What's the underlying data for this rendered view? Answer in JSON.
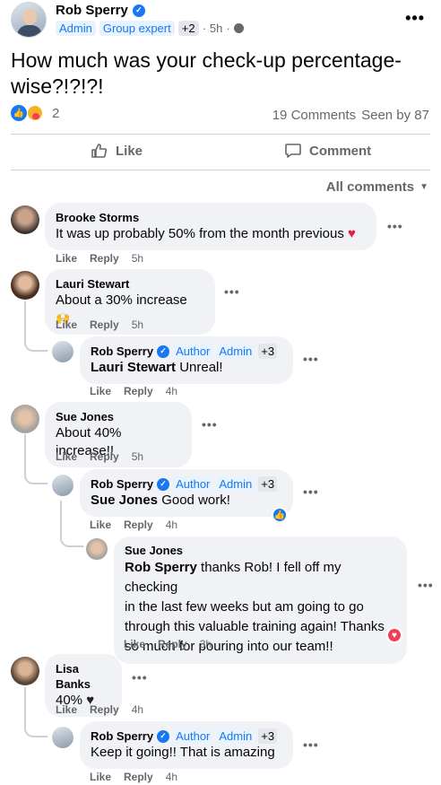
{
  "post": {
    "author": "Rob Sperry",
    "badges": [
      "Admin",
      "Group expert",
      "+2"
    ],
    "time": "5h",
    "text": "How much was your check-up percentage-wise?!?!?!",
    "reaction_count": "2",
    "comments_count": "19 Comments",
    "seen_by": "Seen by 87"
  },
  "actions": {
    "like": "Like",
    "comment": "Comment"
  },
  "filter": {
    "label": "All comments"
  },
  "comment_actions": {
    "like": "Like",
    "reply": "Reply"
  },
  "comments": [
    {
      "name": "Brooke Storms",
      "text": "It was up probably 50% from the month previous",
      "time": "5h"
    },
    {
      "name": "Lauri Stewart",
      "text": "About a 30% increase",
      "time": "5h"
    },
    {
      "name": "Rob Sperry",
      "badges": [
        "Author",
        "Admin",
        "+3"
      ],
      "tag": "Lauri Stewart",
      "text": "Unreal!",
      "time": "4h"
    },
    {
      "name": "Sue Jones",
      "text": "About 40% increase!!",
      "time": "5h"
    },
    {
      "name": "Rob Sperry",
      "badges": [
        "Author",
        "Admin",
        "+3"
      ],
      "tag": "Sue Jones",
      "text": "Good work!",
      "time": "4h"
    },
    {
      "name": "Sue Jones",
      "tag": "Rob Sperry",
      "text_lines": [
        "thanks Rob! I fell off my checking",
        "in the last few weeks but am going to go",
        "through this valuable training again! Thanks",
        "so much for pouring into our team!!"
      ],
      "time": "3h"
    },
    {
      "name": "Lisa Banks",
      "text": "40%",
      "time": "4h"
    },
    {
      "name": "Rob Sperry",
      "badges": [
        "Author",
        "Admin",
        "+3"
      ],
      "text": "Keep it going!! That is amazing",
      "time": "4h"
    }
  ],
  "colors": {
    "accent": "#1877f2",
    "bubble": "#f0f2f5",
    "muted": "#65676b"
  }
}
